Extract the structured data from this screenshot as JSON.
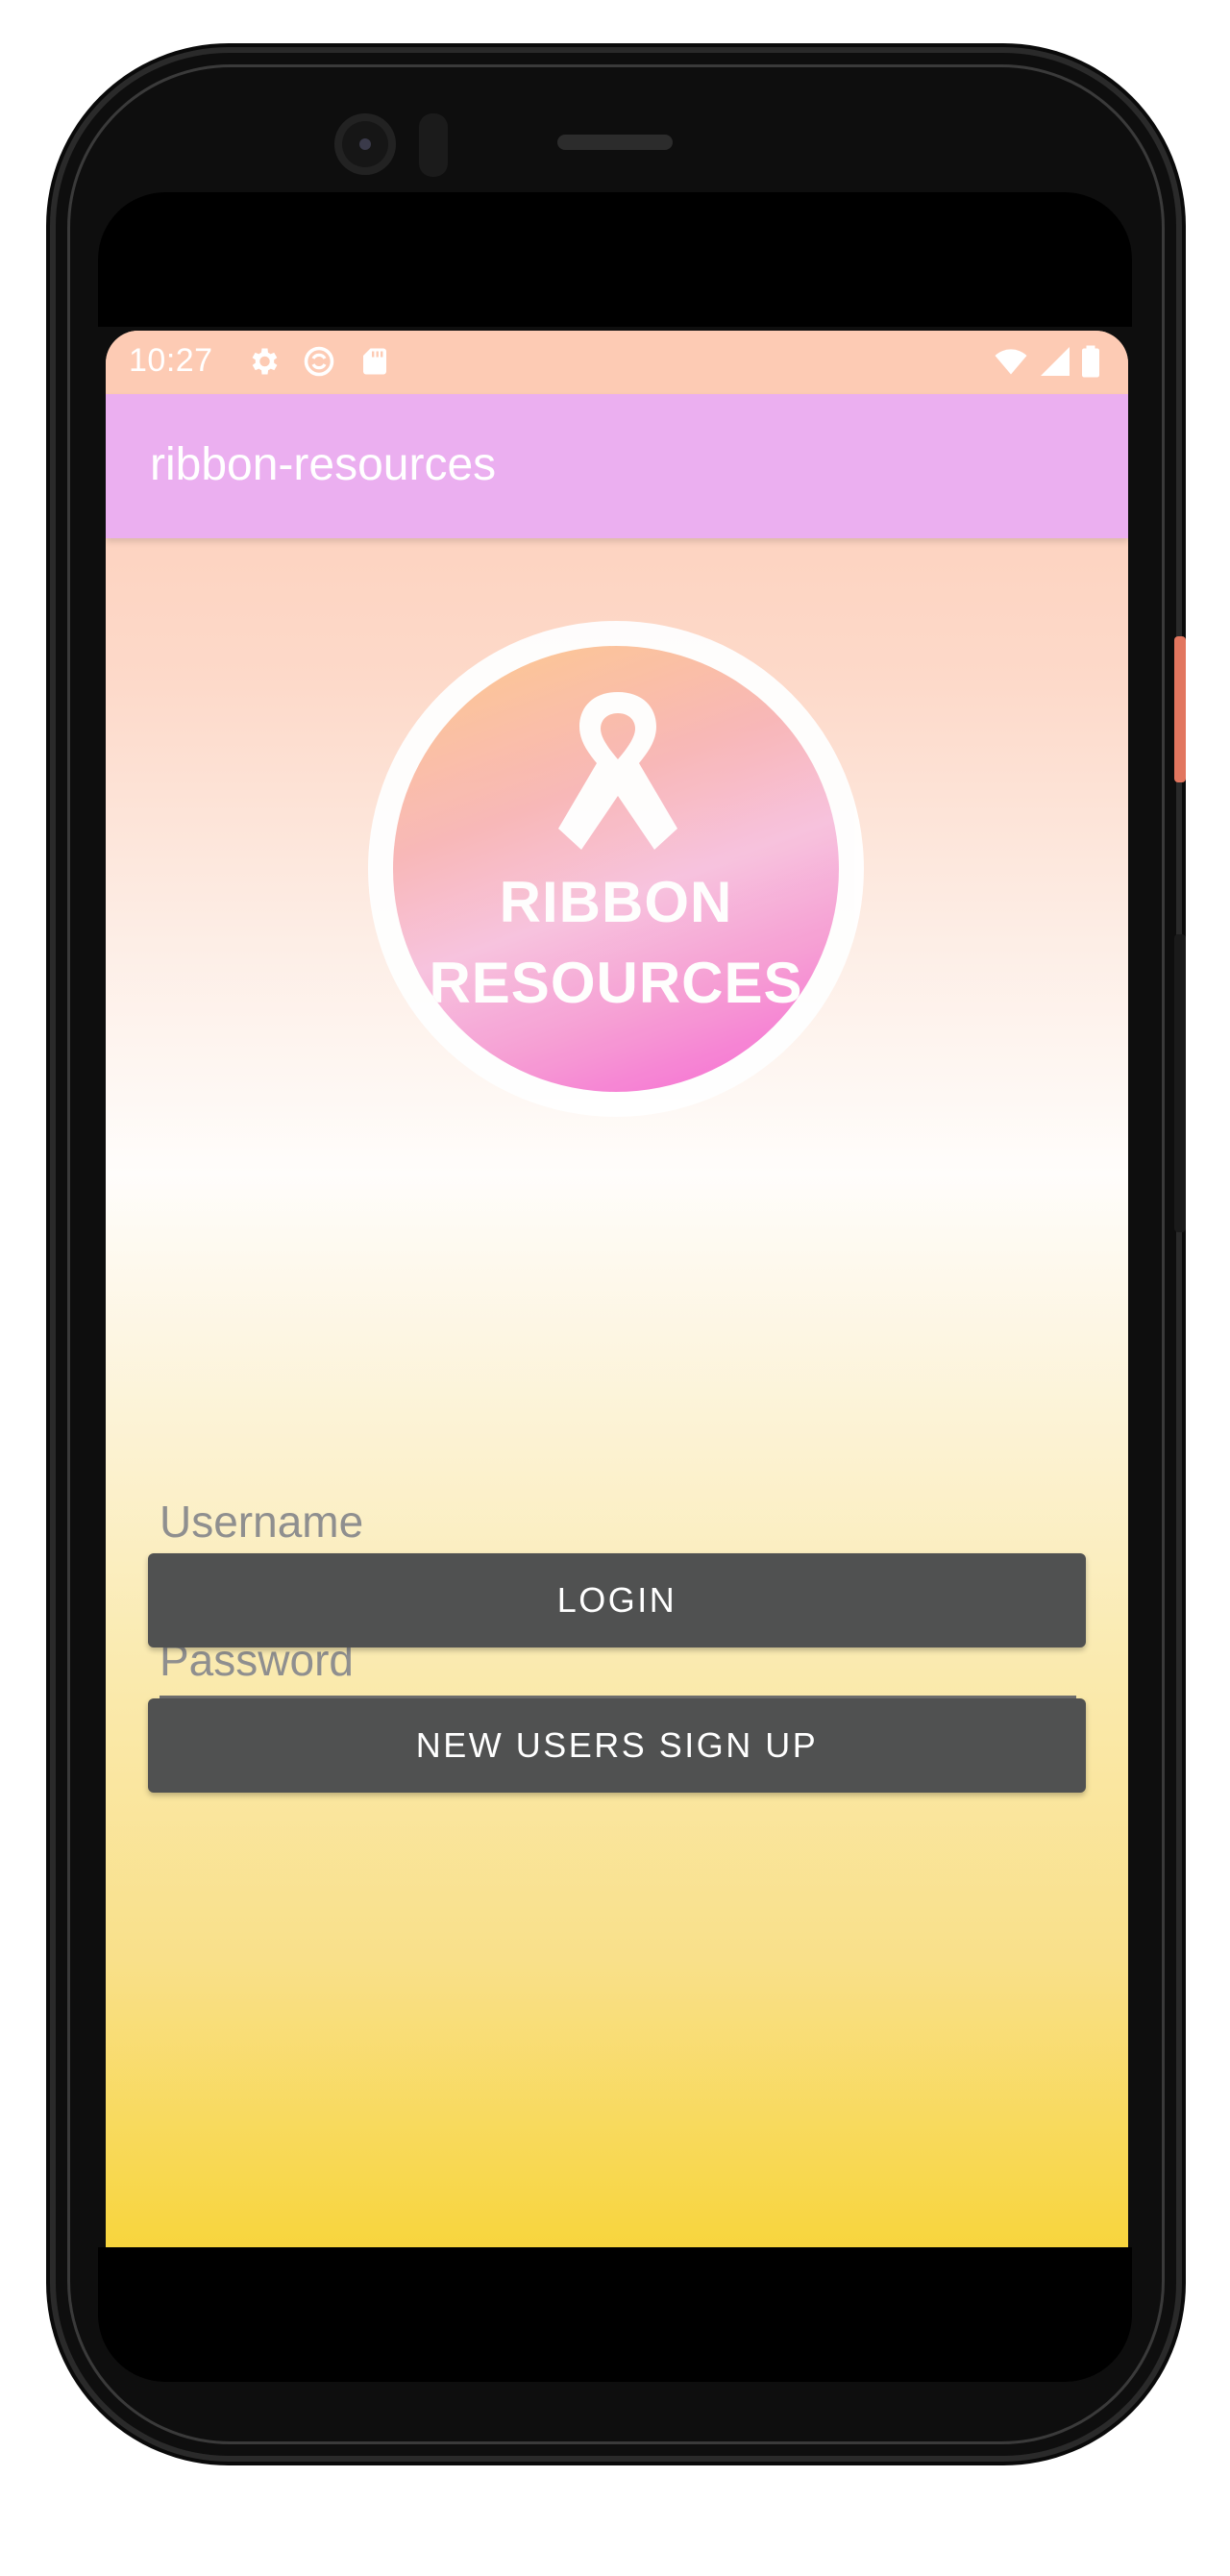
{
  "status_bar": {
    "time": "10:27",
    "left_icons": [
      "gear-icon",
      "sync-icon",
      "sd-card-icon"
    ],
    "right_icons": [
      "wifi-icon",
      "signal-icon",
      "battery-icon"
    ]
  },
  "app_bar": {
    "title": "ribbon-resources"
  },
  "logo": {
    "line1": "RIBBON",
    "line2": "RESOURCES"
  },
  "form": {
    "username_placeholder": "Username",
    "username_value": "",
    "password_placeholder": "Password",
    "password_value": ""
  },
  "buttons": {
    "login_label": "LOGIN",
    "signup_label": "NEW USERS SIGN UP"
  },
  "colors": {
    "status_bar": "#fdcbb4",
    "app_bar": "#ebaff0",
    "button": "#505151",
    "gradient_bottom": "#f8d53d"
  }
}
